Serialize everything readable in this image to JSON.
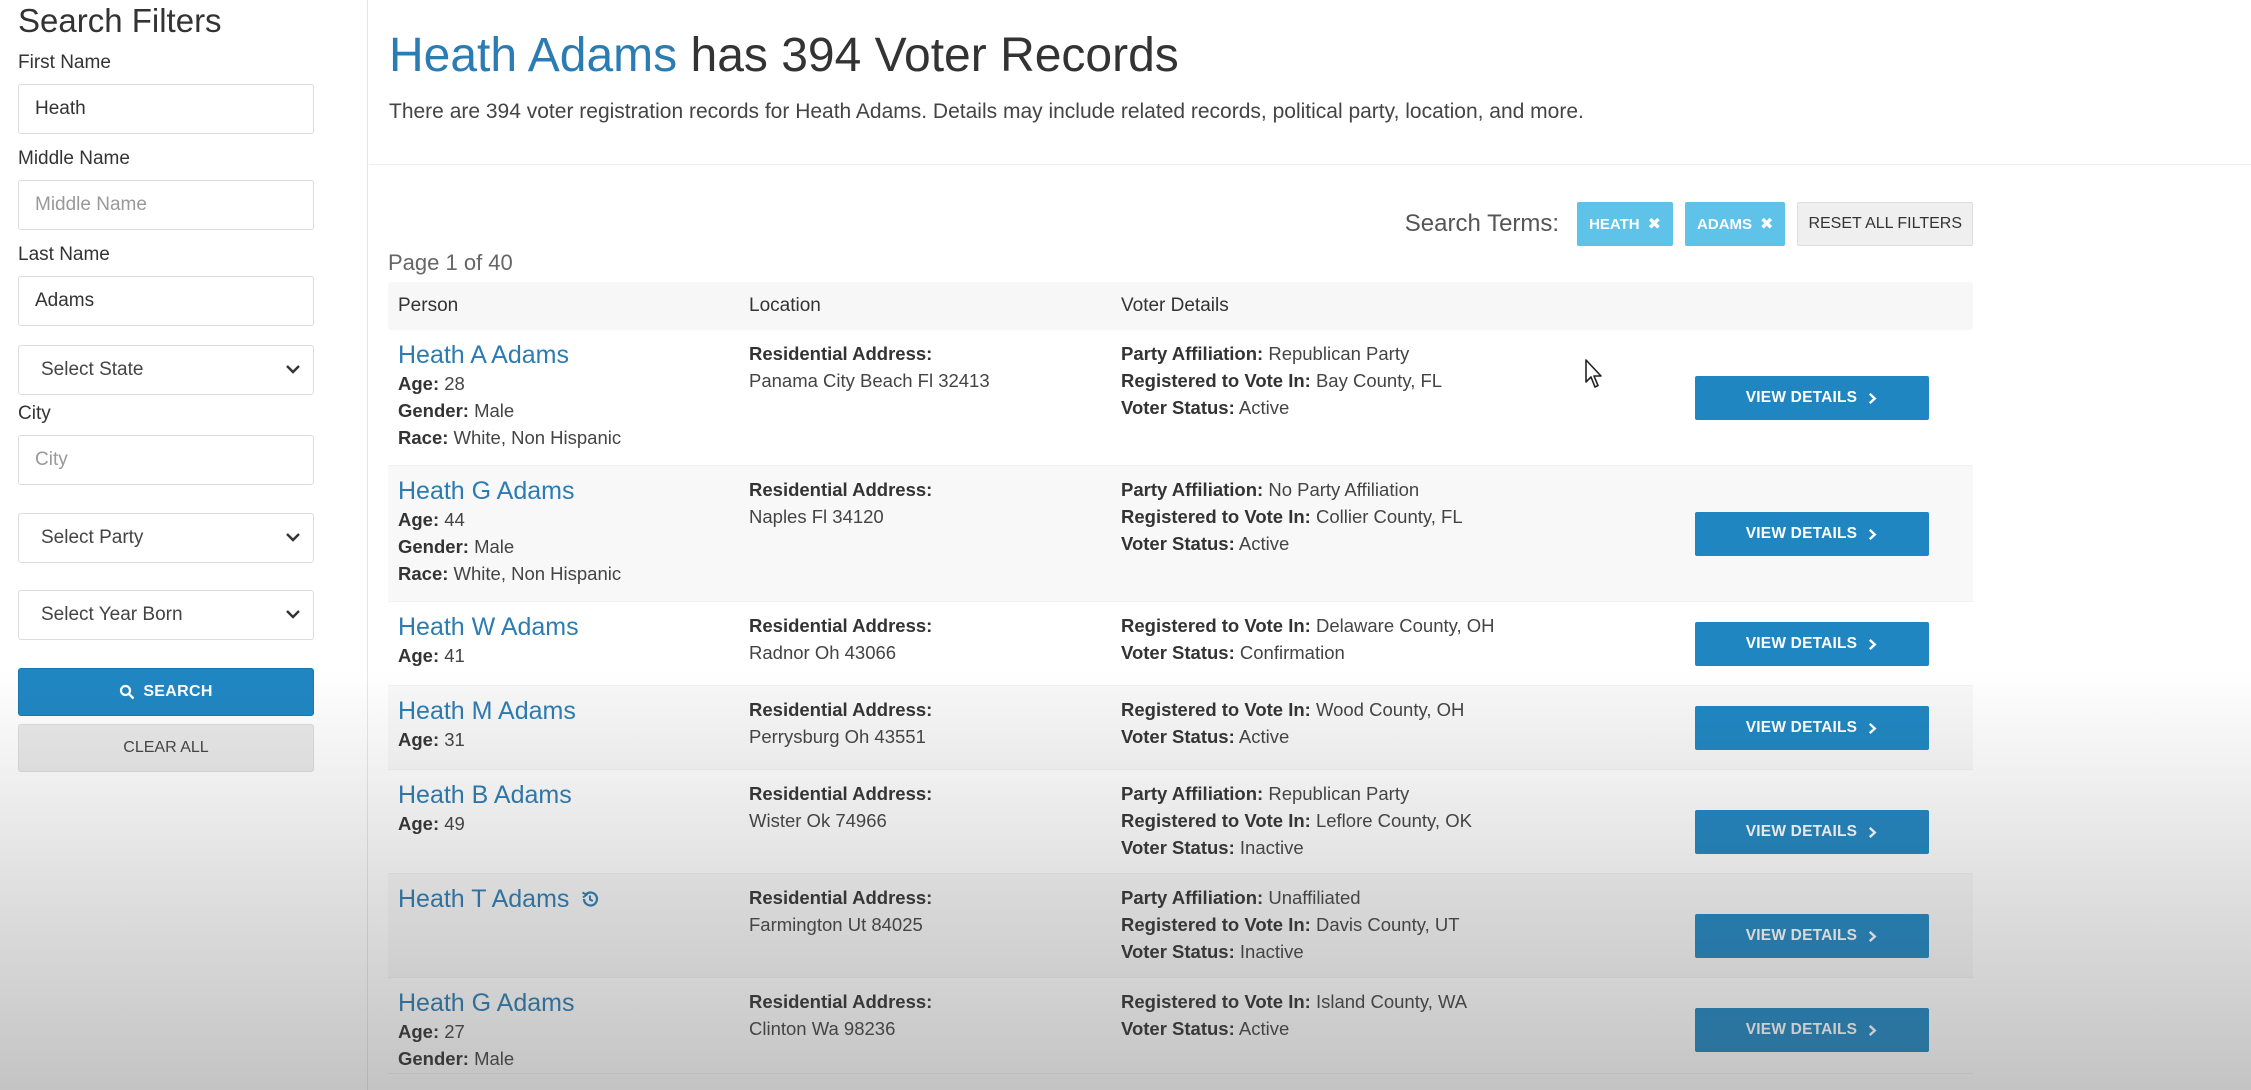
{
  "sidebar": {
    "title": "Search Filters",
    "first_name": {
      "label": "First Name",
      "value": "Heath"
    },
    "middle_name": {
      "label": "Middle Name",
      "placeholder": "Middle Name",
      "value": ""
    },
    "last_name": {
      "label": "Last Name",
      "value": "Adams"
    },
    "state_select": "Select State",
    "city": {
      "label": "City",
      "placeholder": "City",
      "value": ""
    },
    "party_select": "Select Party",
    "year_select": "Select Year Born",
    "search_button": "SEARCH",
    "clear_button": "CLEAR ALL"
  },
  "header": {
    "name": "Heath Adams",
    "title_suffix": " has 394 Voter Records",
    "subtitle": "There are 394 voter registration records for Heath Adams. Details may include related records, political party, location, and more."
  },
  "search_terms": {
    "label": "Search Terms:",
    "chips": [
      "HEATH",
      "ADAMS"
    ],
    "reset_label": "RESET ALL FILTERS"
  },
  "page_indicator": "Page 1 of 40",
  "table": {
    "columns": [
      "Person",
      "Location",
      "Voter Details"
    ],
    "view_label": "VIEW DETAILS",
    "rows": [
      {
        "name": "Heath A Adams",
        "person_lines": [
          [
            "Age:",
            " 28"
          ],
          [
            "Gender:",
            " Male"
          ],
          [
            "Race:",
            " White, Non Hispanic"
          ]
        ],
        "address_label": "Residential Address:",
        "address": "Panama City Beach Fl 32413",
        "voter_lines": [
          [
            "Party Affiliation:",
            " Republican Party"
          ],
          [
            "Registered to Vote In:",
            " Bay County, FL"
          ],
          [
            "Voter Status:",
            " Active"
          ]
        ]
      },
      {
        "name": "Heath G Adams",
        "person_lines": [
          [
            "Age:",
            " 44"
          ],
          [
            "Gender:",
            " Male"
          ],
          [
            "Race:",
            " White, Non Hispanic"
          ]
        ],
        "address_label": "Residential Address:",
        "address": "Naples Fl 34120",
        "voter_lines": [
          [
            "Party Affiliation:",
            " No Party Affiliation"
          ],
          [
            "Registered to Vote In:",
            " Collier County, FL"
          ],
          [
            "Voter Status:",
            " Active"
          ]
        ]
      },
      {
        "name": "Heath W Adams",
        "person_lines": [
          [
            "Age:",
            " 41"
          ]
        ],
        "address_label": "Residential Address:",
        "address": "Radnor Oh 43066",
        "voter_lines": [
          [
            "Registered to Vote In:",
            " Delaware County, OH"
          ],
          [
            "Voter Status:",
            " Confirmation"
          ]
        ]
      },
      {
        "name": "Heath M Adams",
        "person_lines": [
          [
            "Age:",
            " 31"
          ]
        ],
        "address_label": "Residential Address:",
        "address": "Perrysburg Oh 43551",
        "voter_lines": [
          [
            "Registered to Vote In:",
            " Wood County, OH"
          ],
          [
            "Voter Status:",
            " Active"
          ]
        ]
      },
      {
        "name": "Heath B Adams",
        "person_lines": [
          [
            "Age:",
            " 49"
          ]
        ],
        "address_label": "Residential Address:",
        "address": "Wister Ok 74966",
        "voter_lines": [
          [
            "Party Affiliation:",
            " Republican Party"
          ],
          [
            "Registered to Vote In:",
            " Leflore County, OK"
          ],
          [
            "Voter Status:",
            " Inactive"
          ]
        ]
      },
      {
        "name": "Heath T Adams",
        "history_icon": "history-icon",
        "person_lines": [],
        "address_label": "Residential Address:",
        "address": "Farmington Ut 84025",
        "voter_lines": [
          [
            "Party Affiliation:",
            " Unaffiliated"
          ],
          [
            "Registered to Vote In:",
            " Davis County, UT"
          ],
          [
            "Voter Status:",
            " Inactive"
          ]
        ]
      },
      {
        "name": "Heath G Adams",
        "person_lines": [
          [
            "Age:",
            " 27"
          ],
          [
            "Gender:",
            " Male"
          ]
        ],
        "address_label": "Residential Address:",
        "address": "Clinton Wa 98236",
        "voter_lines": [
          [
            "Registered to Vote In:",
            " Island County, WA"
          ],
          [
            "Voter Status:",
            " Active"
          ]
        ]
      }
    ]
  },
  "colors": {
    "accent": "#1f86c2",
    "link": "#2a7cb3",
    "chip": "#5fc2e8"
  }
}
